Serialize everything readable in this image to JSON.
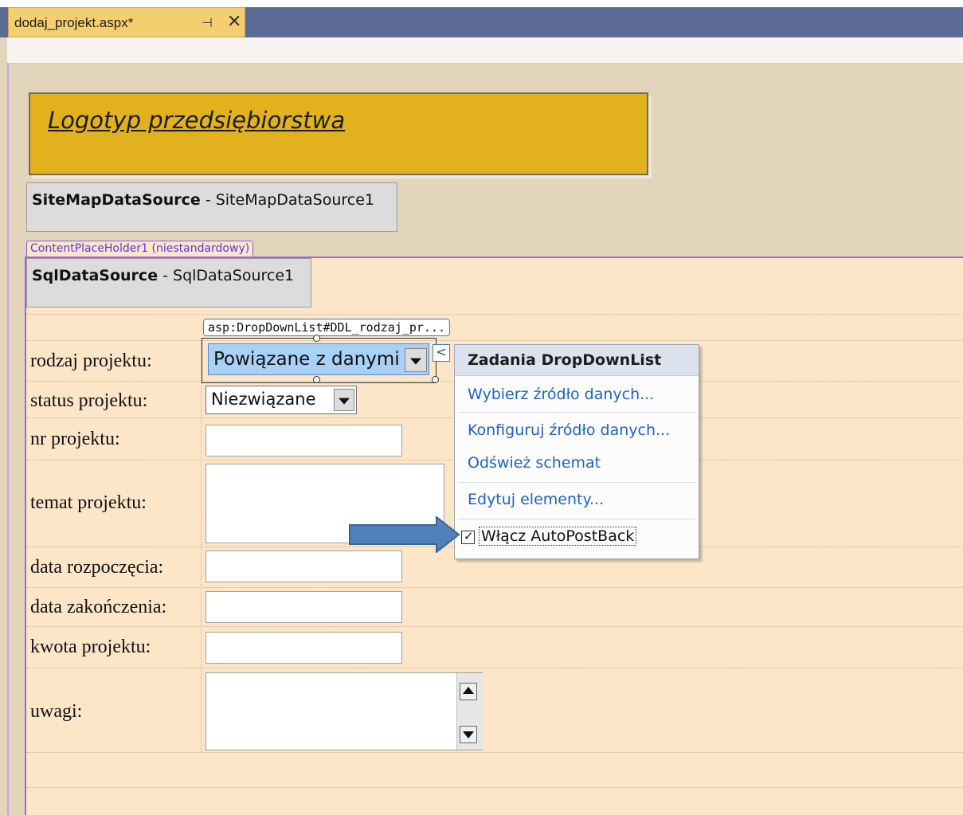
{
  "tab": {
    "title": "dodaj_projekt.aspx*",
    "pin_glyph": "⊣",
    "close_glyph": "✕"
  },
  "logo": {
    "text": "Logotyp przedsiębiorstwa"
  },
  "sitemap_source": {
    "type": "SiteMapDataSource",
    "separator": " - ",
    "id": "SiteMapDataSource1"
  },
  "content_placeholder": {
    "label": "ContentPlaceHolder1 (niestandardowy)"
  },
  "sql_source": {
    "type": "SqlDataSource",
    "separator": " - ",
    "id": "SqlDataSource1"
  },
  "dropdown_tag": "asp:DropDownList#DDL_rodzaj_pr...",
  "smart_tag_glyph": "<",
  "form": {
    "rodzaj_label": "rodzaj projektu:",
    "rodzaj_value": "Powiązane z danymi",
    "status_label": "status projektu:",
    "status_value": "Niezwiązane",
    "nr_label": "nr projektu:",
    "temat_label": "temat projektu:",
    "data_start_label": "data rozpoczęcia:",
    "data_end_label": "data zakończenia:",
    "kwota_label": "kwota projektu:",
    "uwagi_label": "uwagi:"
  },
  "tasks_panel": {
    "title": "Zadania DropDownList",
    "choose_source": "Wybierz źródło danych...",
    "configure_source": "Konfiguruj źródło danych...",
    "refresh_schema": "Odśwież schemat",
    "edit_items": "Edytuj elementy...",
    "autopostback_label": "Włącz AutoPostBack",
    "autopostback_checked": true
  },
  "colors": {
    "arrow": "#4f81bd",
    "logo_bg": "#e1b21d",
    "tab_bar": "#5c6b96",
    "link": "#1c63c7"
  }
}
